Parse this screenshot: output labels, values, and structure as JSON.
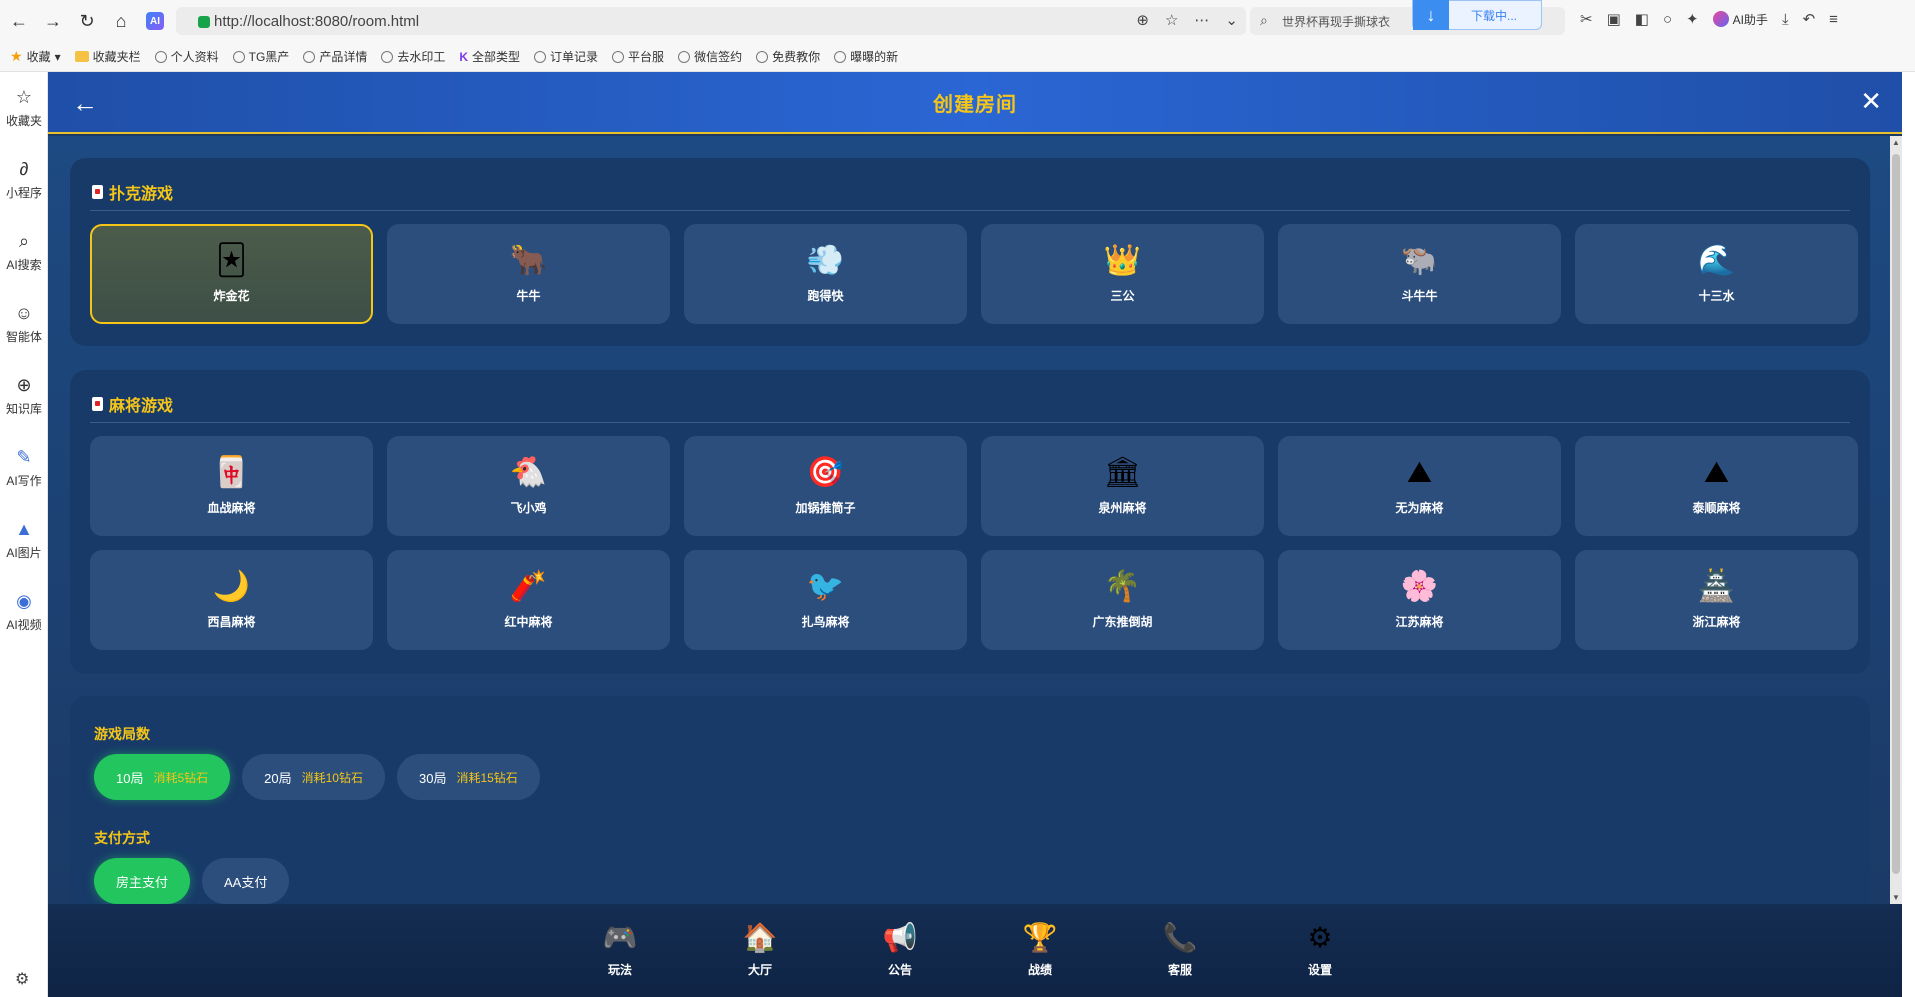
{
  "browser": {
    "url": "http://localhost:8080/room.html",
    "search_text": "世界杯再现手撕球衣",
    "download_label": "下载中...",
    "ai_helper_label": "AI助手"
  },
  "bookmarks": [
    {
      "label": "收藏",
      "icon": "star-icon"
    },
    {
      "label": "收藏夹栏",
      "icon": "folder-icon"
    },
    {
      "label": "个人资料",
      "icon": "globe-icon"
    },
    {
      "label": "TG黑产",
      "icon": "globe-icon"
    },
    {
      "label": "产品详情",
      "icon": "globe-icon"
    },
    {
      "label": "去水印工",
      "icon": "globe-icon"
    },
    {
      "label": "全部类型",
      "icon": "k-icon"
    },
    {
      "label": "订单记录",
      "icon": "globe-icon"
    },
    {
      "label": "平台服",
      "icon": "globe-icon"
    },
    {
      "label": "微信签约",
      "icon": "globe-icon"
    },
    {
      "label": "免费教你",
      "icon": "globe-icon"
    },
    {
      "label": "曝曝的新",
      "icon": "globe-icon"
    }
  ],
  "sidebar": [
    {
      "label": "收藏夹",
      "icon": "star-icon"
    },
    {
      "label": "小程序",
      "icon": "mini-program-icon"
    },
    {
      "label": "AI搜索",
      "icon": "search-icon"
    },
    {
      "label": "智能体",
      "icon": "agent-icon"
    },
    {
      "label": "知识库",
      "icon": "knowledge-icon"
    },
    {
      "label": "AI写作",
      "icon": "write-icon"
    },
    {
      "label": "AI图片",
      "icon": "image-icon"
    },
    {
      "label": "AI视频",
      "icon": "video-icon"
    }
  ],
  "header": {
    "title": "创建房间",
    "back_glyph": "←",
    "close_glyph": "✕"
  },
  "poker": {
    "title": "扑克游戏",
    "games": [
      {
        "label": "炸金花",
        "icon": "🃏",
        "selected": true
      },
      {
        "label": "牛牛",
        "icon": "🐂"
      },
      {
        "label": "跑得快",
        "icon": "💨"
      },
      {
        "label": "三公",
        "icon": "👑"
      },
      {
        "label": "斗牛牛",
        "icon": "🐃"
      },
      {
        "label": "十三水",
        "icon": "🌊"
      }
    ]
  },
  "mahjong": {
    "title": "麻将游戏",
    "games": [
      {
        "label": "血战麻将",
        "icon": "🀄"
      },
      {
        "label": "飞小鸡",
        "icon": "🐔"
      },
      {
        "label": "加锅推筒子",
        "icon": "🎯"
      },
      {
        "label": "泉州麻将",
        "icon": "🏛"
      },
      {
        "label": "无为麻将",
        "icon": "⛰"
      },
      {
        "label": "泰顺麻将",
        "icon": "⛰"
      },
      {
        "label": "西昌麻将",
        "icon": "🌙"
      },
      {
        "label": "红中麻将",
        "icon": "🧨"
      },
      {
        "label": "扎鸟麻将",
        "icon": "🐦"
      },
      {
        "label": "广东推倒胡",
        "icon": "🌴"
      },
      {
        "label": "江苏麻将",
        "icon": "🌸"
      },
      {
        "label": "浙江麻将",
        "icon": "🏯"
      }
    ]
  },
  "options": {
    "rounds_label": "游戏局数",
    "rounds": [
      {
        "label": "10局",
        "cost": "消耗5钻石",
        "active": true
      },
      {
        "label": "20局",
        "cost": "消耗10钻石"
      },
      {
        "label": "30局",
        "cost": "消耗15钻石"
      }
    ],
    "pay_label": "支付方式",
    "pay": [
      {
        "label": "房主支付",
        "active": true
      },
      {
        "label": "AA支付"
      }
    ]
  },
  "bottom_nav": [
    {
      "label": "玩法",
      "icon": "🎮"
    },
    {
      "label": "大厅",
      "icon": "🏠"
    },
    {
      "label": "公告",
      "icon": "📢"
    },
    {
      "label": "战绩",
      "icon": "🏆"
    },
    {
      "label": "客服",
      "icon": "📞"
    },
    {
      "label": "设置",
      "icon": "⚙"
    }
  ],
  "colors": {
    "accent": "#f5c518",
    "app_bg": "#1b3a66",
    "card_bg": "#2b4e7d",
    "active_green": "#22c55e"
  }
}
